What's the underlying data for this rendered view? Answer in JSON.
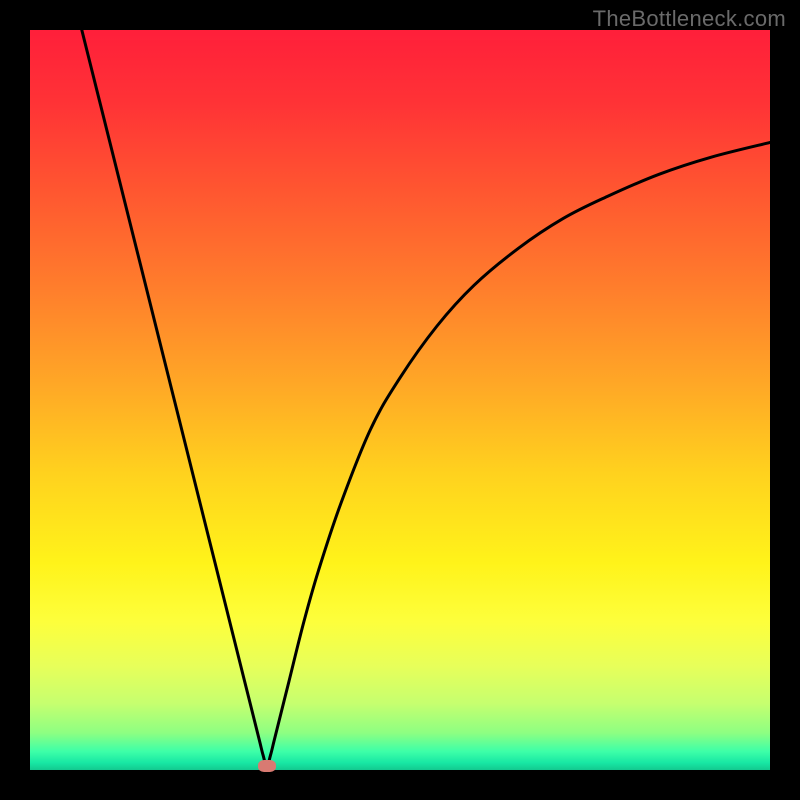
{
  "attribution": "TheBottleneck.com",
  "colors": {
    "bg": "#000000",
    "gradient_stops": [
      {
        "offset": 0.0,
        "color": "#ff1f3a"
      },
      {
        "offset": 0.1,
        "color": "#ff3336"
      },
      {
        "offset": 0.22,
        "color": "#ff5730"
      },
      {
        "offset": 0.35,
        "color": "#ff7e2c"
      },
      {
        "offset": 0.48,
        "color": "#ffa826"
      },
      {
        "offset": 0.6,
        "color": "#ffd21e"
      },
      {
        "offset": 0.72,
        "color": "#fff31a"
      },
      {
        "offset": 0.8,
        "color": "#fdff3c"
      },
      {
        "offset": 0.86,
        "color": "#e7ff5a"
      },
      {
        "offset": 0.91,
        "color": "#c6ff6f"
      },
      {
        "offset": 0.95,
        "color": "#8dff82"
      },
      {
        "offset": 0.975,
        "color": "#3dffa8"
      },
      {
        "offset": 0.99,
        "color": "#18e8a4"
      },
      {
        "offset": 1.0,
        "color": "#13c98f"
      }
    ],
    "curve": "#000000",
    "marker": "#d87a72"
  },
  "chart_data": {
    "type": "line",
    "title": "",
    "xlabel": "",
    "ylabel": "",
    "xlim": [
      0,
      100
    ],
    "ylim": [
      0,
      100
    ],
    "grid": false,
    "legend": false,
    "series": [
      {
        "name": "curve",
        "x": [
          7,
          9,
          11,
          13,
          15,
          17,
          19,
          21,
          23,
          25,
          27,
          29,
          30,
          31,
          31.5,
          32,
          32.5,
          33,
          34,
          35,
          37,
          39,
          42,
          46,
          50,
          55,
          60,
          66,
          72,
          78,
          85,
          92,
          100
        ],
        "y": [
          100,
          92,
          84,
          76,
          68,
          60,
          52,
          44,
          36,
          28,
          20,
          12,
          8,
          4,
          2,
          0.5,
          2,
          4,
          8,
          12,
          20,
          27,
          36,
          46,
          53,
          60,
          65.5,
          70.5,
          74.5,
          77.5,
          80.5,
          82.8,
          84.8
        ]
      }
    ],
    "marker": {
      "x": 32,
      "y": 0.5
    }
  }
}
